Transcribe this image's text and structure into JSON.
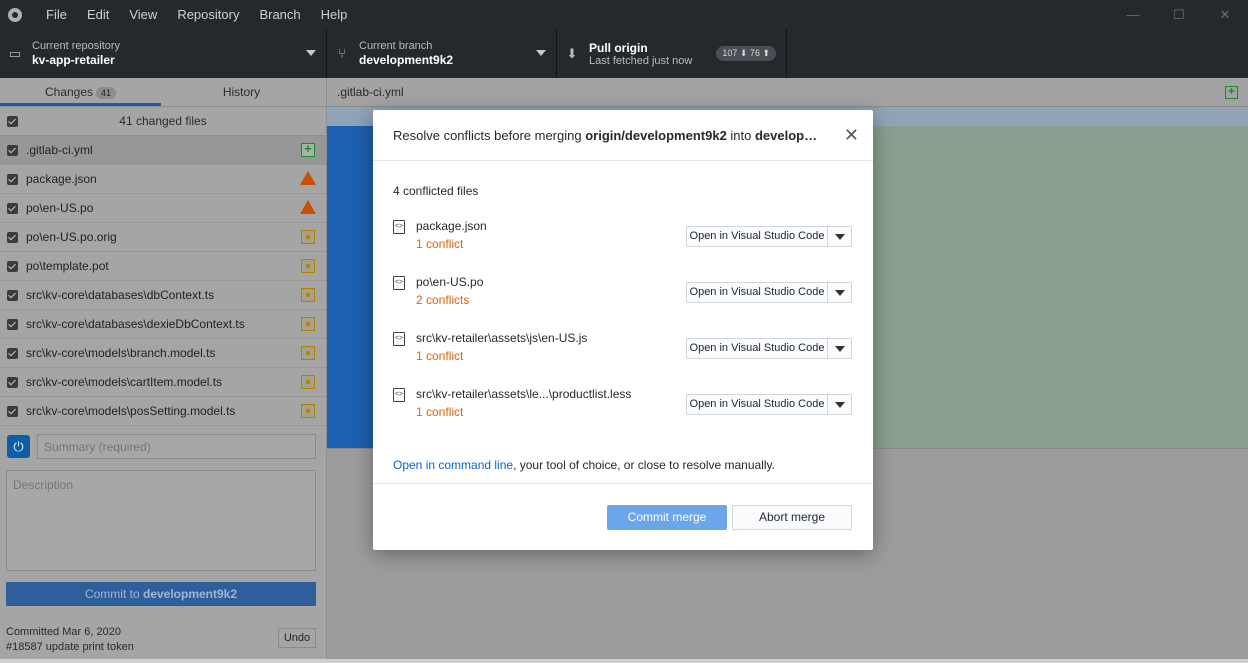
{
  "menu": [
    "File",
    "Edit",
    "View",
    "Repository",
    "Branch",
    "Help"
  ],
  "window_controls": [
    "—",
    "☐",
    "✕"
  ],
  "toolbar": {
    "repo_label": "Current repository",
    "repo_value": "kv-app-retailer",
    "branch_label": "Current branch",
    "branch_value": "development9k2",
    "pull_label": "Pull origin",
    "pull_sub": "Last fetched just now",
    "ahead_behind": "107 ⬇ 76 ⬆"
  },
  "tabs": {
    "changes": "Changes",
    "changes_count": "41",
    "history": "History"
  },
  "changes_header": "41 changed files",
  "files": [
    {
      "name": ".gitlab-ci.yml",
      "status": "added"
    },
    {
      "name": "package.json",
      "status": "conflict"
    },
    {
      "name": "po\\en-US.po",
      "status": "conflict"
    },
    {
      "name": "po\\en-US.po.orig",
      "status": "modified"
    },
    {
      "name": "po\\template.pot",
      "status": "modified"
    },
    {
      "name": "src\\kv-core\\databases\\dbContext.ts",
      "status": "modified"
    },
    {
      "name": "src\\kv-core\\databases\\dexieDbContext.ts",
      "status": "modified"
    },
    {
      "name": "src\\kv-core\\models\\branch.model.ts",
      "status": "modified"
    },
    {
      "name": "src\\kv-core\\models\\cartItem.model.ts",
      "status": "modified"
    },
    {
      "name": "src\\kv-core\\models\\posSetting.model.ts",
      "status": "modified"
    }
  ],
  "commit": {
    "summary_placeholder": "Summary (required)",
    "description_placeholder": "Description",
    "button_prefix": "Commit to ",
    "button_branch": "development9k2",
    "last_commit_date": "Committed Mar 6, 2020",
    "last_commit_msg": "#18587 update print token",
    "undo": "Undo"
  },
  "diff": {
    "filename": ".gitlab-ci.yml"
  },
  "modal": {
    "title_prefix": "Resolve conflicts before merging ",
    "title_source": "origin/development9k2",
    "title_mid": " into ",
    "title_target": "develop…",
    "conflict_count": "4 conflicted files",
    "items": [
      {
        "name": "package.json",
        "conflicts": "1 conflict"
      },
      {
        "name": "po\\en-US.po",
        "conflicts": "2 conflicts"
      },
      {
        "name": "src\\kv-retailer\\assets\\js\\en-US.js",
        "conflicts": "1 conflict"
      },
      {
        "name": "src\\kv-retailer\\assets\\le...\\productlist.less",
        "conflicts": "1 conflict"
      }
    ],
    "open_label": "Open in Visual Studio Code",
    "hint_link": "Open in command line",
    "hint_rest": ", your tool of choice, or close to resolve manually.",
    "commit_merge": "Commit merge",
    "abort_merge": "Abort merge"
  }
}
